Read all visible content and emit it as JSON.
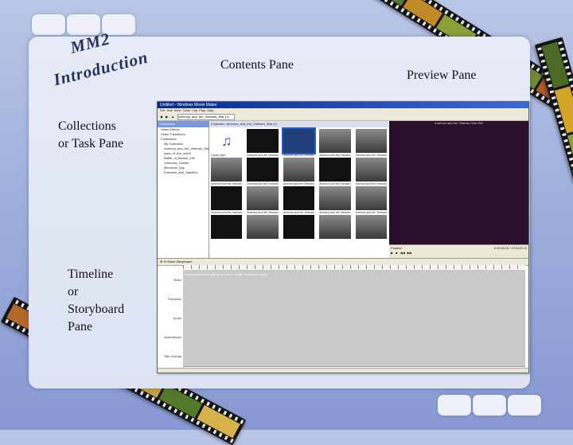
{
  "slide": {
    "title_lines": [
      "MM2",
      "Introduction"
    ],
    "labels": {
      "collections": [
        "Collections",
        "or Task Pane"
      ],
      "contents": "Contents Pane",
      "preview": "Preview Pane",
      "timeline": [
        "Timeline",
        "or",
        "Storyboard",
        "Pane"
      ]
    }
  },
  "app": {
    "window_title": "Untitled - Windows Movie Maker",
    "menus": [
      "File",
      "Edit",
      "View",
      "Tools",
      "Clip",
      "Play",
      "Help"
    ],
    "toolbar_combo": "America_and_the_Vietnam_War (1)",
    "collections": {
      "header": "Collections",
      "items": [
        "Video Effects",
        "Video Transitions",
        "Collections",
        "My Collection",
        "America_and_the_Vietnam_War",
        "eyes_of_the_world",
        "Battle_of_Bunker_Hill",
        "Unknown_Soldier",
        "Memorial_Day",
        "Freedom_and_Sacrifice"
      ]
    },
    "contents_header": "Collection: America_and_the_Vietnam_War (1)",
    "clips": [
      {
        "caption": "Lasser light",
        "kind": "music"
      },
      {
        "caption": "America and the Vietnam...",
        "kind": "dark"
      },
      {
        "caption": "America and the Vietnam...",
        "kind": "selected"
      },
      {
        "caption": "America and the Vietnam...",
        "kind": "grey"
      },
      {
        "caption": "America and the Vietnam...",
        "kind": "grey"
      },
      {
        "caption": "America and the Vietnam...",
        "kind": "grey"
      },
      {
        "caption": "America and the Vietnam...",
        "kind": "dark"
      },
      {
        "caption": "America and the Vietnam...",
        "kind": "grey"
      },
      {
        "caption": "America and the Vietnam...",
        "kind": "dark"
      },
      {
        "caption": "America and the Vietnam...",
        "kind": "grey"
      },
      {
        "caption": "America and the Vietnam...",
        "kind": "dark"
      },
      {
        "caption": "America and the Vietnam...",
        "kind": "grey"
      },
      {
        "caption": "America and the Vietnam...",
        "kind": "dark"
      },
      {
        "caption": "America and the Vietnam...",
        "kind": "grey"
      },
      {
        "caption": "America and the Vietnam...",
        "kind": "grey"
      },
      {
        "caption": "",
        "kind": "dark"
      },
      {
        "caption": "",
        "kind": "grey"
      },
      {
        "caption": "",
        "kind": "dark"
      },
      {
        "caption": "",
        "kind": "grey"
      },
      {
        "caption": "",
        "kind": "grey"
      }
    ],
    "preview": {
      "header": "America and the Vietnam War 002",
      "status_left": "Paused",
      "status_right": "0:00:00.00 / 0:00:03.00"
    },
    "timeline": {
      "toolbar_label": "Show Storyboard",
      "tracks": [
        {
          "name": "Video",
          "hint": "Drag a media clip and drop it here to start creating a movie."
        },
        {
          "name": "Transition",
          "hint": ""
        },
        {
          "name": "Audio",
          "hint": ""
        },
        {
          "name": "Audio/Music",
          "hint": ""
        },
        {
          "name": "Title Overlay",
          "hint": ""
        }
      ]
    }
  }
}
